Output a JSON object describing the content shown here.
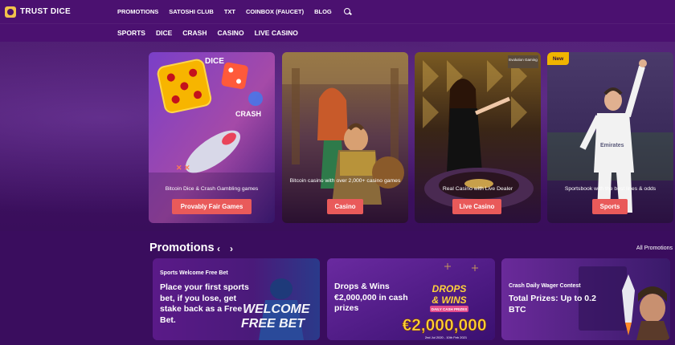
{
  "brand": {
    "name": "TRUST DICE"
  },
  "topnav": [
    "PROMOTIONS",
    "SATOSHI CLUB",
    "TXT",
    "COINBOX (FAUCET)",
    "BLOG"
  ],
  "subnav": [
    "SPORTS",
    "DICE",
    "CRASH",
    "CASINO",
    "LIVE CASINO"
  ],
  "cards": [
    {
      "caption": "Bitcoin Dice & Crash Gambling games",
      "button": "Provably Fair Games",
      "art_labels": [
        "DICE",
        "CRASH"
      ]
    },
    {
      "caption": "Bitcoin casino with over 2,000+ casino games",
      "button": "Casino"
    },
    {
      "caption": "Real Casino with Live Dealer",
      "button": "Live Casino",
      "art_label": "Evolution Gaming"
    },
    {
      "caption": "Sportsbook with the best lines & odds",
      "button": "Sports",
      "badge": "New",
      "art_label": "Emirates"
    }
  ],
  "promotions": {
    "title": "Promotions",
    "prev": "‹",
    "next": "›",
    "all_link": "All Promotions",
    "items": [
      {
        "small": "Sports Welcome Free Bet",
        "big": "Place your first sports bet, if you lose, get stake back as a Free Bet.",
        "art_lines": [
          "WELCOME",
          "FREE BET"
        ]
      },
      {
        "big": "Drops & Wins €2,000,000 in cash prizes",
        "art_lines": [
          "DROPS",
          "& WINS",
          "DAILY CASH PRIZES",
          "€2,000,000",
          "2nd Jul 2020 - 10th Feb 2021"
        ]
      },
      {
        "small": "Crash Daily Wager Contest",
        "big": "Total Prizes: Up to 0.2 BTC"
      }
    ]
  },
  "colors": {
    "accent": "#e95a5a",
    "header": "#4b1170",
    "background": "#3a0d5e",
    "badge": "#f0b400"
  }
}
